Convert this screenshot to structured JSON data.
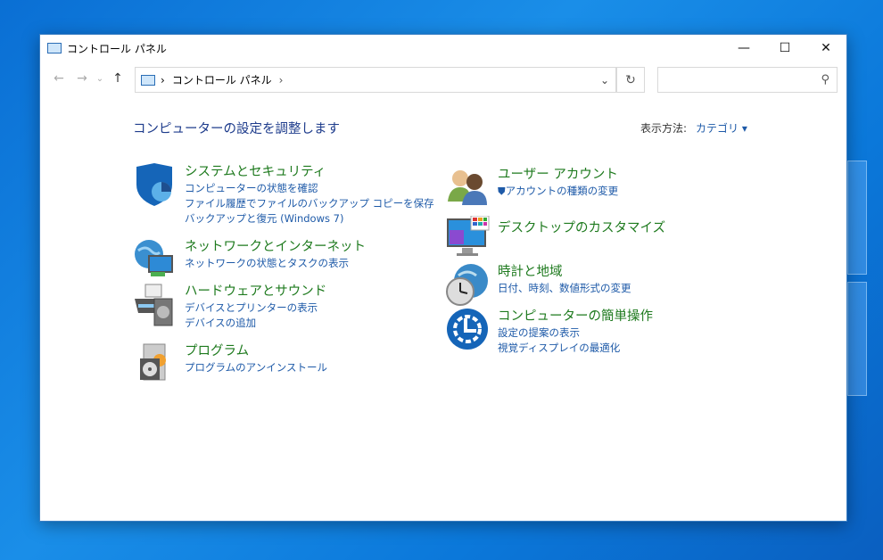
{
  "window": {
    "title": "コントロール パネル",
    "minimize": "—",
    "maximize": "☐",
    "close": "✕"
  },
  "nav": {
    "back": "←",
    "forward": "→",
    "recent": "⌄",
    "up": "↑",
    "breadcrumb": "コントロール パネル",
    "chevron": "›",
    "dropdown": "⌄",
    "refresh": "↻",
    "search_icon": "⚲",
    "search_placeholder": ""
  },
  "page": {
    "title": "コンピューターの設定を調整します",
    "view_label": "表示方法:",
    "view_value": "カテゴリ ▾"
  },
  "categories": [
    {
      "title": "システムとセキュリティ",
      "links": [
        "コンピューターの状態を確認",
        "ファイル履歴でファイルのバックアップ コピーを保存",
        "バックアップと復元 (Windows 7)"
      ]
    },
    {
      "title": "ネットワークとインターネット",
      "links": [
        "ネットワークの状態とタスクの表示"
      ]
    },
    {
      "title": "ハードウェアとサウンド",
      "links": [
        "デバイスとプリンターの表示",
        "デバイスの追加"
      ]
    },
    {
      "title": "プログラム",
      "links": [
        "プログラムのアンインストール"
      ]
    },
    {
      "title": "ユーザー アカウント",
      "links": [
        "アカウントの種類の変更"
      ]
    },
    {
      "title": "デスクトップのカスタマイズ",
      "links": []
    },
    {
      "title": "時計と地域",
      "links": [
        "日付、時刻、数値形式の変更"
      ]
    },
    {
      "title": "コンピューターの簡単操作",
      "links": [
        "設定の提案の表示",
        "視覚ディスプレイの最適化"
      ]
    }
  ]
}
